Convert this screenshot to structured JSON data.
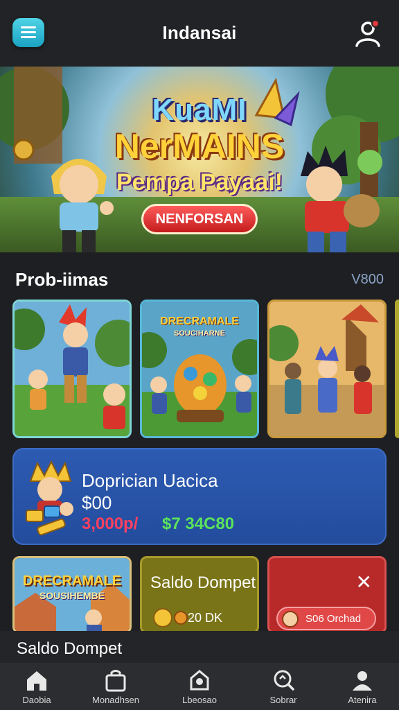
{
  "header": {
    "title": "Indansai"
  },
  "hero": {
    "title_line1": "KuaMI",
    "title_line2": "NerMAINS",
    "subtitle": "Pempa Payaai!",
    "cta_label": "NENFORSAN"
  },
  "section": {
    "title": "Prob-iimas",
    "link": "V800"
  },
  "game_cards": [
    {
      "name": "adventure-heroes-card",
      "border": "#7fd6d8"
    },
    {
      "name": "treasure-card",
      "title": "DRECRAMALE",
      "subtitle": "SOUCIHARNE",
      "border": "#58b8d8"
    },
    {
      "name": "village-heroes-card",
      "border": "#c89a3c"
    }
  ],
  "promo": {
    "title": "Doprician Uacica",
    "value": "$00",
    "old_price": "3,000p/",
    "new_price": "$7 34C80"
  },
  "tiles": {
    "game_title": "DRECRAMALE",
    "game_subtitle": "SOUSIHEMBE",
    "wallet_label": "Saldo Dompet",
    "wallet_balance": "20 DK",
    "pill_label": "S06 Orchad"
  },
  "wallet_strip": {
    "label": "Saldo Dompet"
  },
  "bottom_nav": [
    {
      "label": "Daobia",
      "icon": "home-icon"
    },
    {
      "label": "Monadhsen",
      "icon": "bag-icon"
    },
    {
      "label": "Lbeosao",
      "icon": "location-icon"
    },
    {
      "label": "Sobrar",
      "icon": "search-icon"
    },
    {
      "label": "Atenira",
      "icon": "user-icon"
    }
  ],
  "colors": {
    "accent": "#1aa2c2",
    "promo_bg": "#2d5bb2",
    "tile_wallet_bg": "#7a7418",
    "tile_red_bg": "#b82a2a"
  }
}
